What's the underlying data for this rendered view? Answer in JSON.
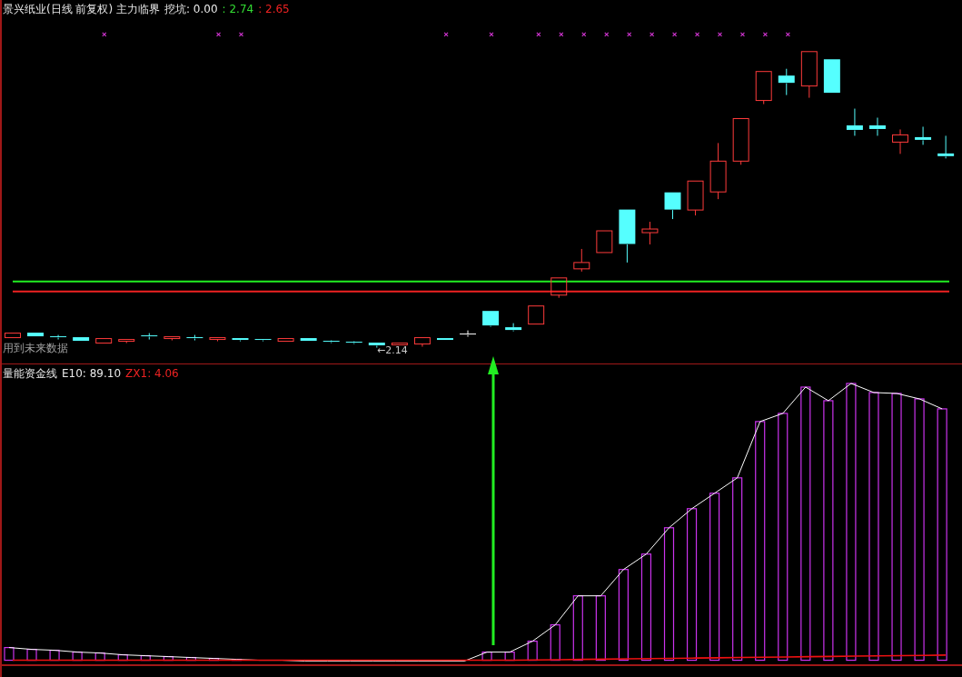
{
  "price_panel": {
    "title": "景兴纸业(日线 前复权) 主力临界",
    "legend": [
      {
        "text": "挖坑: 0.00",
        "color": "#e8e8e8"
      },
      {
        "text": ": 2.74",
        "color": "#33dd33"
      },
      {
        "text": ": 2.65",
        "color": "#ee2222"
      }
    ],
    "note": "用到未来数据",
    "low_label": "←2.14"
  },
  "indicator_panel": {
    "title": "量能资金线",
    "legend": [
      {
        "text": "E10: 89.10",
        "color": "#e8e8e8"
      },
      {
        "text": "ZX1: 4.06",
        "color": "#ee2222"
      }
    ]
  }
}
